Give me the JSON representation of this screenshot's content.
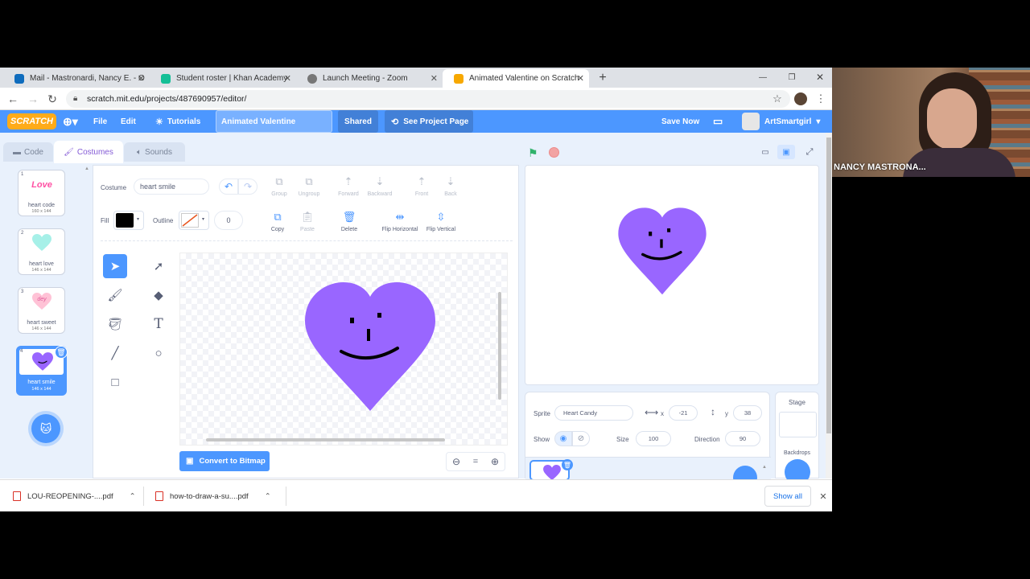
{
  "browser": {
    "tabs": [
      {
        "label": "Mail - Mastronardi, Nancy E. - O",
        "fav_color": "#0f6cbd"
      },
      {
        "label": "Student roster | Khan Academy",
        "fav_color": "#14bf96"
      },
      {
        "label": "Launch Meeting - Zoom",
        "fav_color": "#555555"
      },
      {
        "label": "Animated Valentine on Scratch",
        "fav_color": "#f7a800"
      }
    ],
    "new_tab": "+",
    "url": "scratch.mit.edu/projects/487690957/editor/"
  },
  "menu": {
    "logo": "SCRATCH",
    "file": "File",
    "edit": "Edit",
    "tutorials": "Tutorials",
    "project_title": "Animated Valentine",
    "shared": "Shared",
    "see_project_page": "See Project Page",
    "save_now": "Save Now",
    "username": "ArtSmartgirl",
    "accent": "#4c97ff"
  },
  "editor_tabs": {
    "code": "Code",
    "costumes": "Costumes",
    "sounds": "Sounds"
  },
  "costumes": [
    {
      "num": "1",
      "name": "heart code",
      "size": "160 x 144",
      "art": "Love"
    },
    {
      "num": "2",
      "name": "heart love",
      "size": "146 x 144",
      "art": ""
    },
    {
      "num": "3",
      "name": "heart sweet",
      "size": "146 x 144",
      "art": "dey"
    },
    {
      "num": "4",
      "name": "heart smile",
      "size": "146 x 144",
      "art": ""
    }
  ],
  "paint": {
    "costume_label": "Costume",
    "costume_name": "heart smile",
    "fill_label": "Fill",
    "outline_label": "Outline",
    "outline_width": "0",
    "fill_color": "#000000",
    "heart_color": "#9966ff",
    "top_buttons": [
      {
        "label": "Group"
      },
      {
        "label": "Ungroup"
      },
      {
        "label": "Forward"
      },
      {
        "label": "Backward"
      },
      {
        "label": "Front"
      },
      {
        "label": "Back"
      }
    ],
    "mid_buttons": [
      {
        "label": "Copy"
      },
      {
        "label": "Paste"
      },
      {
        "label": "Delete"
      },
      {
        "label": "Flip Horizontal"
      },
      {
        "label": "Flip Vertical"
      }
    ],
    "convert": "Convert to Bitmap",
    "zoom_reset": "="
  },
  "sprite": {
    "sprite_label": "Sprite",
    "name": "Heart Candy",
    "x_label": "x",
    "x": "-21",
    "y_label": "y",
    "y": "38",
    "show_label": "Show",
    "size_label": "Size",
    "size": "100",
    "direction_label": "Direction",
    "direction": "90"
  },
  "stage_panel": {
    "title": "Stage",
    "backdrops": "Backdrops"
  },
  "downloads": [
    {
      "name": "LOU-REOPENING-....pdf"
    },
    {
      "name": "how-to-draw-a-su....pdf"
    }
  ],
  "show_all": "Show all",
  "webcam": {
    "name": "NANCY MASTRONA..."
  }
}
